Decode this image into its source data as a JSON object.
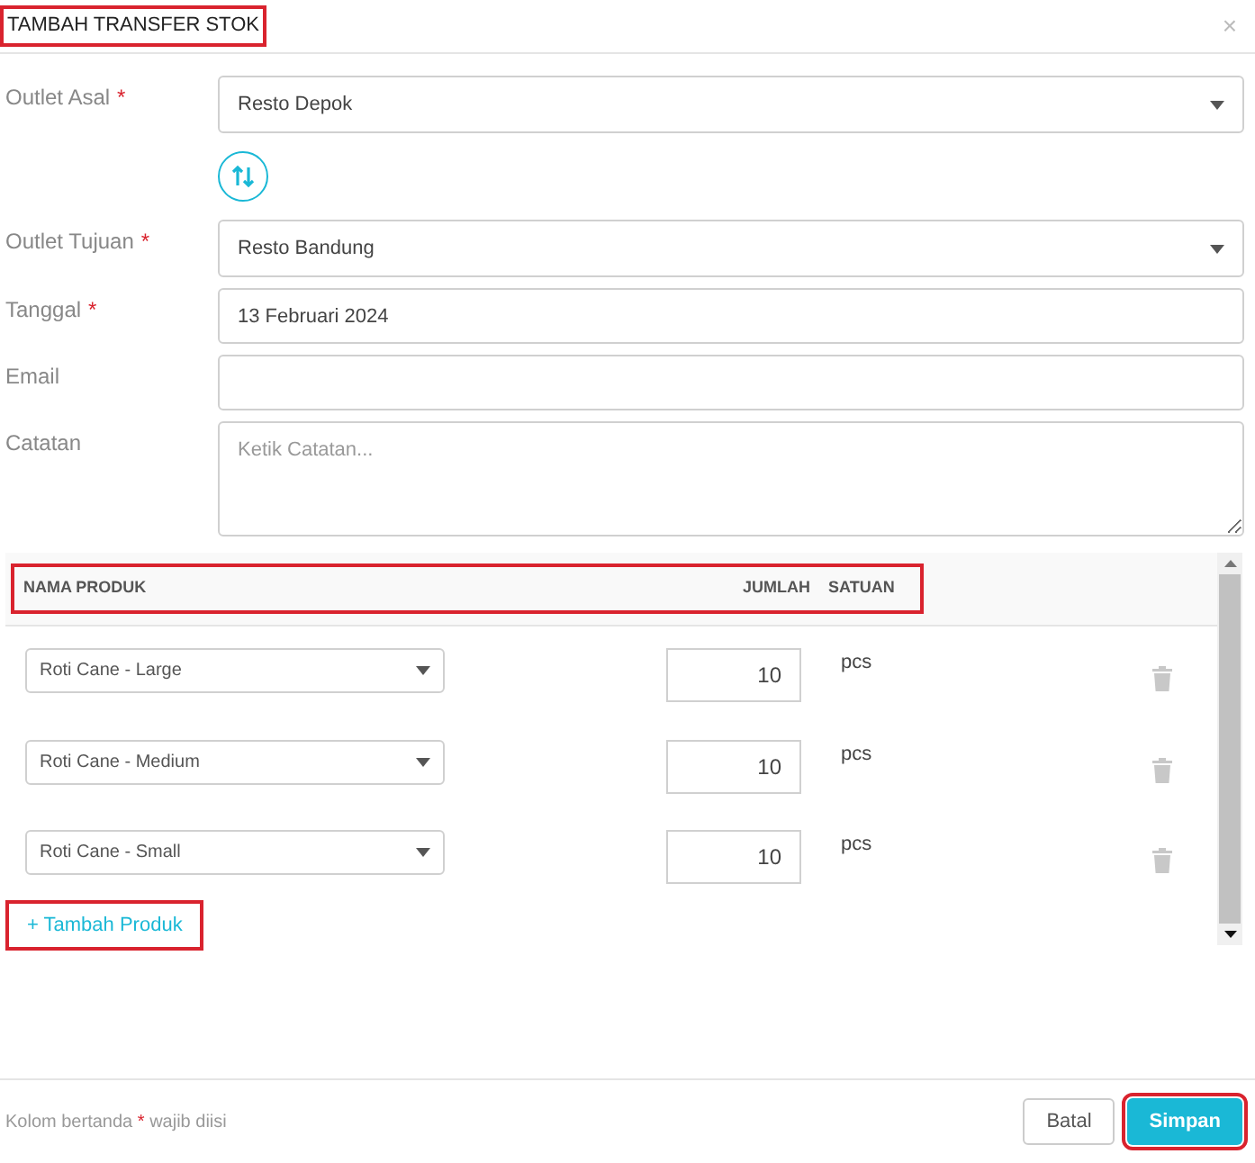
{
  "dialog": {
    "title": "TAMBAH TRANSFER STOK",
    "title_highlighted": true,
    "close": "×"
  },
  "fields": [
    {
      "kind": "select",
      "label": "Outlet Asal",
      "marker": "*",
      "value": "Resto Depok"
    },
    {
      "kind": "swap"
    },
    {
      "kind": "select",
      "label": "Outlet Tujuan",
      "marker": "*",
      "value": "Resto Bandung"
    },
    {
      "kind": "input",
      "label": "Tanggal",
      "marker": "*",
      "value": "13 Februari 2024"
    },
    {
      "kind": "input",
      "label": "Email"
    },
    {
      "kind": "textarea",
      "label": "Catatan",
      "placeholder": "Ketik Catatan..."
    }
  ],
  "table": {
    "columns": [
      "NAMA PRODUK",
      "JUMLAH",
      "SATUAN"
    ],
    "header_highlighted": true,
    "rows": [
      {
        "product": "Roti Cane - Large",
        "quantity": "10",
        "unit": "pcs"
      },
      {
        "product": "Roti Cane - Medium",
        "quantity": "10",
        "unit": "pcs"
      },
      {
        "product": "Roti Cane - Small",
        "quantity": "10",
        "unit": "pcs"
      }
    ],
    "add_link": {
      "label": "+ Tambah Produk",
      "highlighted": true
    }
  },
  "footer": {
    "note_before": "Kolom bertanda",
    "note_mark": "*",
    "note_after": "wajib diisi",
    "buttons": [
      {
        "label": "Batal",
        "kind": "secondary",
        "highlighted": false
      },
      {
        "label": "Simpan",
        "kind": "primary",
        "highlighted": true
      }
    ]
  }
}
